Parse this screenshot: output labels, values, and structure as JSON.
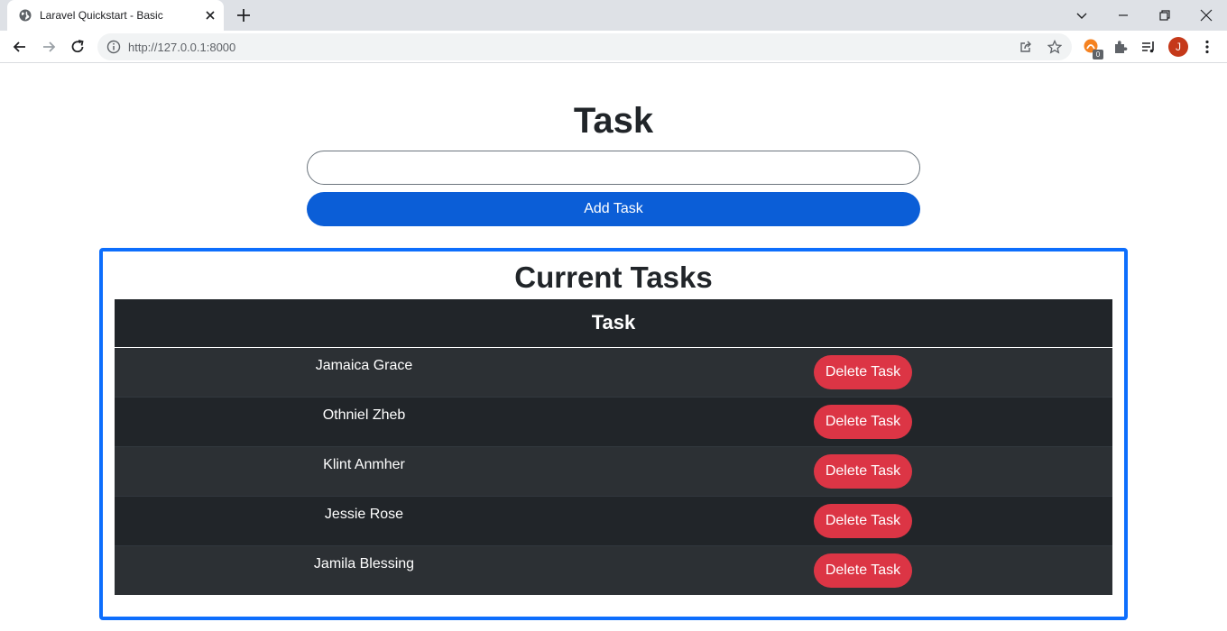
{
  "browser": {
    "tab_title": "Laravel Quickstart - Basic",
    "url": "http://127.0.0.1:8000",
    "extension_badge": "0",
    "profile_initial": "J"
  },
  "page": {
    "heading": "Task",
    "task_input_value": "",
    "add_button_label": "Add Task"
  },
  "tasks_panel": {
    "title": "Current Tasks",
    "column_header": "Task",
    "rows": [
      {
        "name": "Jamaica Grace",
        "action_label": "Delete Task"
      },
      {
        "name": "Othniel Zheb",
        "action_label": "Delete Task"
      },
      {
        "name": "Klint Anmher",
        "action_label": "Delete Task"
      },
      {
        "name": "Jessie Rose",
        "action_label": "Delete Task"
      },
      {
        "name": "Jamila Blessing",
        "action_label": "Delete Task"
      }
    ]
  },
  "colors": {
    "primary_button": "#0b5ed7",
    "danger_button": "#dc3545",
    "panel_border": "#0d6efd",
    "table_dark": "#212529"
  }
}
